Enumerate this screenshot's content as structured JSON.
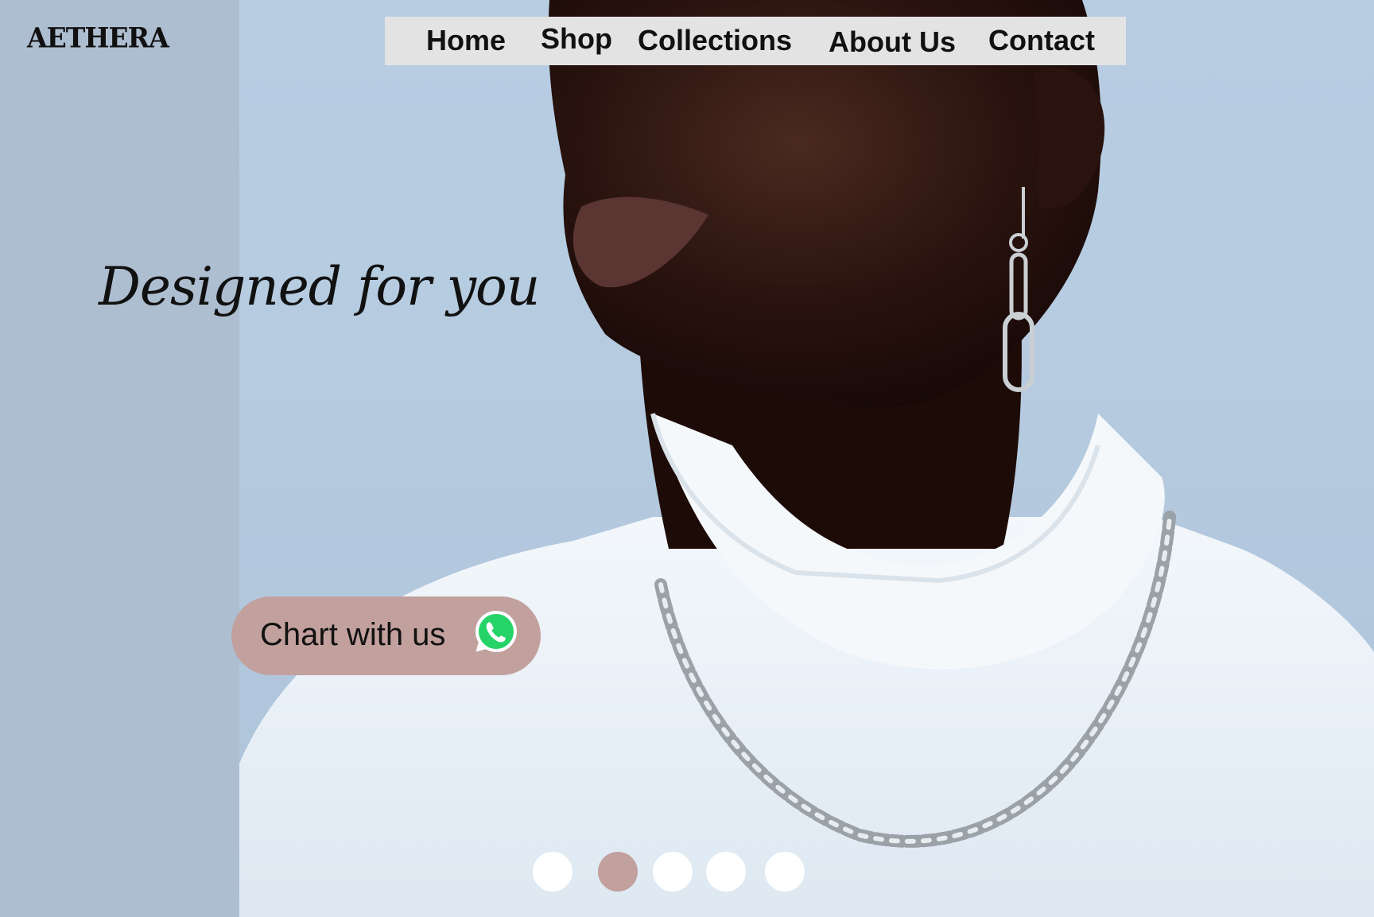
{
  "brand": {
    "logo_text": "AETHERA"
  },
  "nav": {
    "items": [
      {
        "label": "Home"
      },
      {
        "label": "Shop"
      },
      {
        "label": "Collections"
      },
      {
        "label": "About Us"
      },
      {
        "label": "Contact"
      }
    ]
  },
  "hero": {
    "tagline": "Designed for you",
    "image_subject": "model in white turtleneck with silver chain"
  },
  "chat": {
    "label": "Chart with us",
    "icon": "whatsapp-icon"
  },
  "carousel": {
    "count": 5,
    "active_index": 1
  },
  "colors": {
    "accent": "#c1a09d",
    "nav_bg": "#e3e3e3",
    "background": "#aebed1",
    "whatsapp_green": "#25d366"
  }
}
